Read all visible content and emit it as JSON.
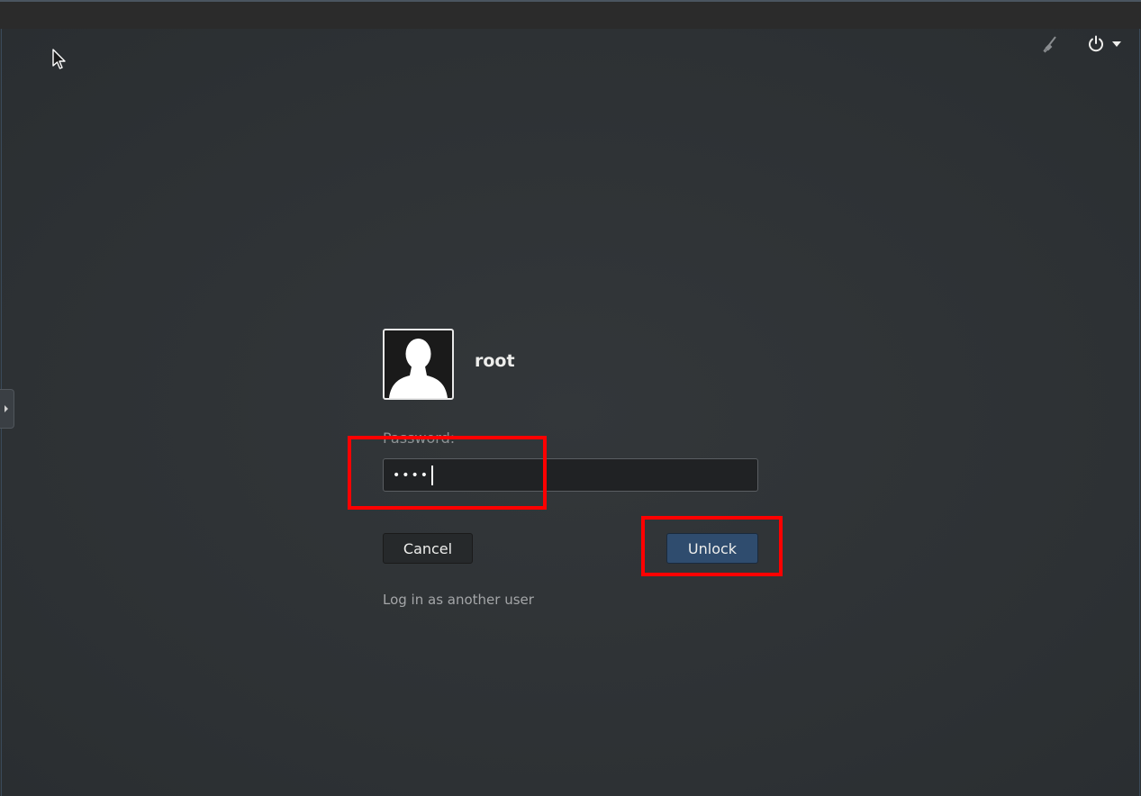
{
  "lock_screen": {
    "username": "root",
    "password_label": "Password:",
    "password_masked": "••••",
    "cancel_label": "Cancel",
    "unlock_label": "Unlock",
    "other_user_label": "Log in as another user"
  },
  "top_bar": {
    "icons": [
      "accessibility-icon",
      "power-icon",
      "chevron-down-icon"
    ]
  },
  "colors": {
    "background": "#2e3235",
    "unlock_button": "#2f4c6e",
    "highlight": "#ff0000"
  }
}
